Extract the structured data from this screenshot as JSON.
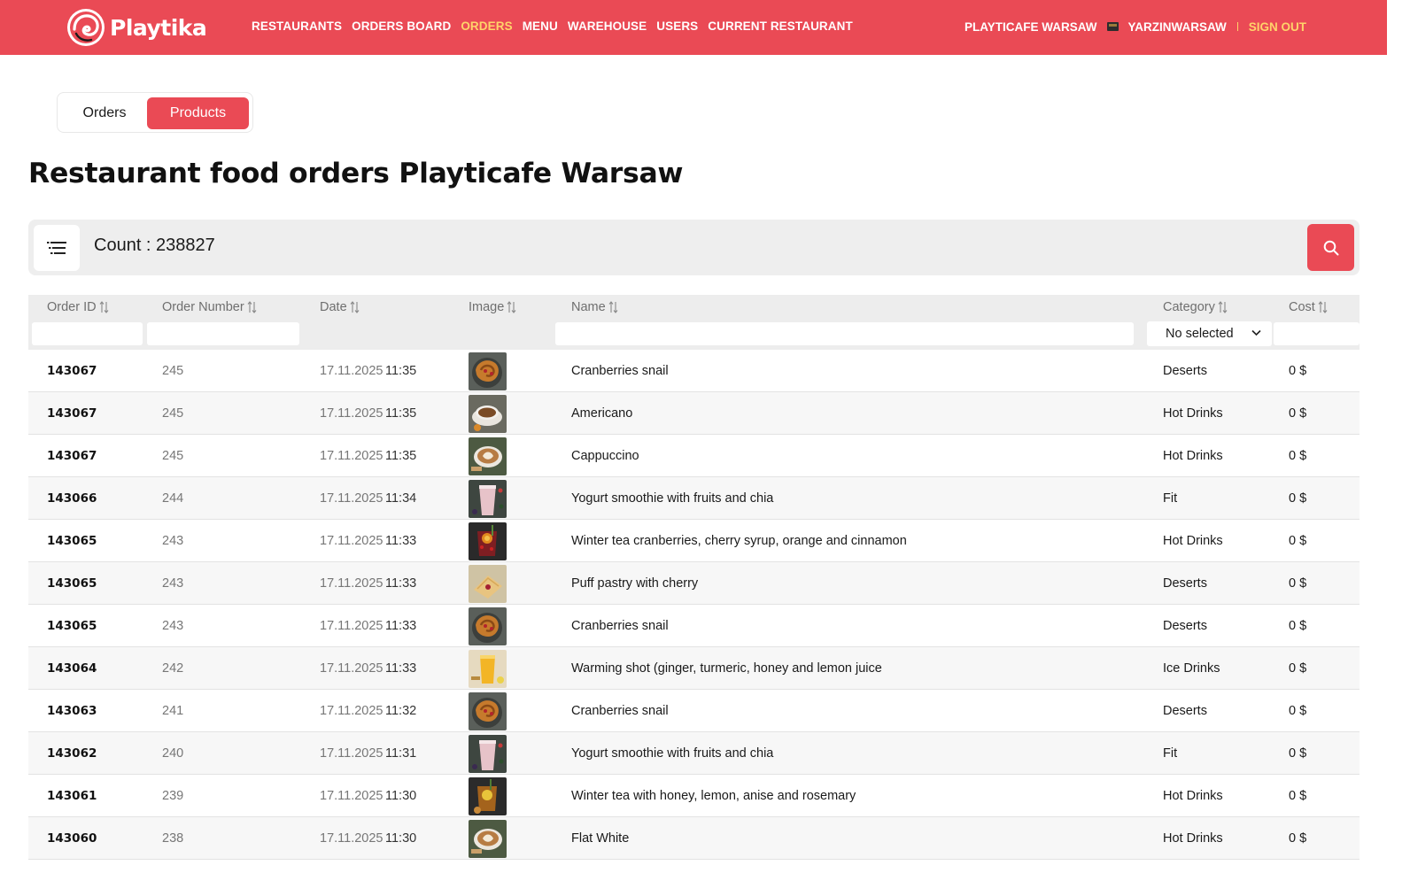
{
  "colors": {
    "brand": "#ea4a55",
    "accent": "#ffd36a"
  },
  "header": {
    "logo_text": "Playtika",
    "nav": [
      {
        "label": "RESTAURANTS",
        "active": false
      },
      {
        "label": "ORDERS BOARD",
        "active": false
      },
      {
        "label": "ORDERS",
        "active": true
      },
      {
        "label": "MENU",
        "active": false
      },
      {
        "label": "WAREHOUSE",
        "active": false
      },
      {
        "label": "USERS",
        "active": false
      },
      {
        "label": "CURRENT RESTAURANT",
        "active": false
      }
    ],
    "restaurant": "PLAYTICAFE WARSAW",
    "username": "YARZINWARSAW",
    "sign_out": "SIGN OUT"
  },
  "toggle": {
    "orders": "Orders",
    "products": "Products",
    "selected": "Products"
  },
  "page_title": "Restaurant food orders Playticafe Warsaw",
  "count_label": "Count : 238827",
  "table": {
    "columns": {
      "order_id": "Order ID",
      "order_number": "Order Number",
      "date": "Date",
      "image": "Image",
      "name": "Name",
      "category": "Category",
      "cost": "Cost"
    },
    "category_filter": "No selected",
    "rows": [
      {
        "id": "143067",
        "num": "245",
        "date": "17.11.2025",
        "time": "11:35",
        "name": "Cranberries snail",
        "category": "Deserts",
        "cost": "0 $",
        "img": "pastry"
      },
      {
        "id": "143067",
        "num": "245",
        "date": "17.11.2025",
        "time": "11:35",
        "name": "Americano",
        "category": "Hot Drinks",
        "cost": "0 $",
        "img": "coffee"
      },
      {
        "id": "143067",
        "num": "245",
        "date": "17.11.2025",
        "time": "11:35",
        "name": "Cappuccino",
        "category": "Hot Drinks",
        "cost": "0 $",
        "img": "latte"
      },
      {
        "id": "143066",
        "num": "244",
        "date": "17.11.2025",
        "time": "11:34",
        "name": "Yogurt smoothie with fruits and chia",
        "category": "Fit",
        "cost": "0 $",
        "img": "smoothie"
      },
      {
        "id": "143065",
        "num": "243",
        "date": "17.11.2025",
        "time": "11:33",
        "name": "Winter tea cranberries, cherry syrup, orange and cinnamon",
        "category": "Hot Drinks",
        "cost": "0 $",
        "img": "tea-red"
      },
      {
        "id": "143065",
        "num": "243",
        "date": "17.11.2025",
        "time": "11:33",
        "name": "Puff pastry with cherry",
        "category": "Deserts",
        "cost": "0 $",
        "img": "puff"
      },
      {
        "id": "143065",
        "num": "243",
        "date": "17.11.2025",
        "time": "11:33",
        "name": "Cranberries snail",
        "category": "Deserts",
        "cost": "0 $",
        "img": "pastry"
      },
      {
        "id": "143064",
        "num": "242",
        "date": "17.11.2025",
        "time": "11:33",
        "name": "Warming shot (ginger, turmeric, honey and lemon juice",
        "category": "Ice Drinks",
        "cost": "0 $",
        "img": "shot"
      },
      {
        "id": "143063",
        "num": "241",
        "date": "17.11.2025",
        "time": "11:32",
        "name": "Cranberries snail",
        "category": "Deserts",
        "cost": "0 $",
        "img": "pastry"
      },
      {
        "id": "143062",
        "num": "240",
        "date": "17.11.2025",
        "time": "11:31",
        "name": "Yogurt smoothie with fruits and chia",
        "category": "Fit",
        "cost": "0 $",
        "img": "smoothie"
      },
      {
        "id": "143061",
        "num": "239",
        "date": "17.11.2025",
        "time": "11:30",
        "name": "Winter tea with honey, lemon, anise and rosemary",
        "category": "Hot Drinks",
        "cost": "0 $",
        "img": "tea-amber"
      },
      {
        "id": "143060",
        "num": "238",
        "date": "17.11.2025",
        "time": "11:30",
        "name": "Flat White",
        "category": "Hot Drinks",
        "cost": "0 $",
        "img": "latte"
      }
    ]
  }
}
